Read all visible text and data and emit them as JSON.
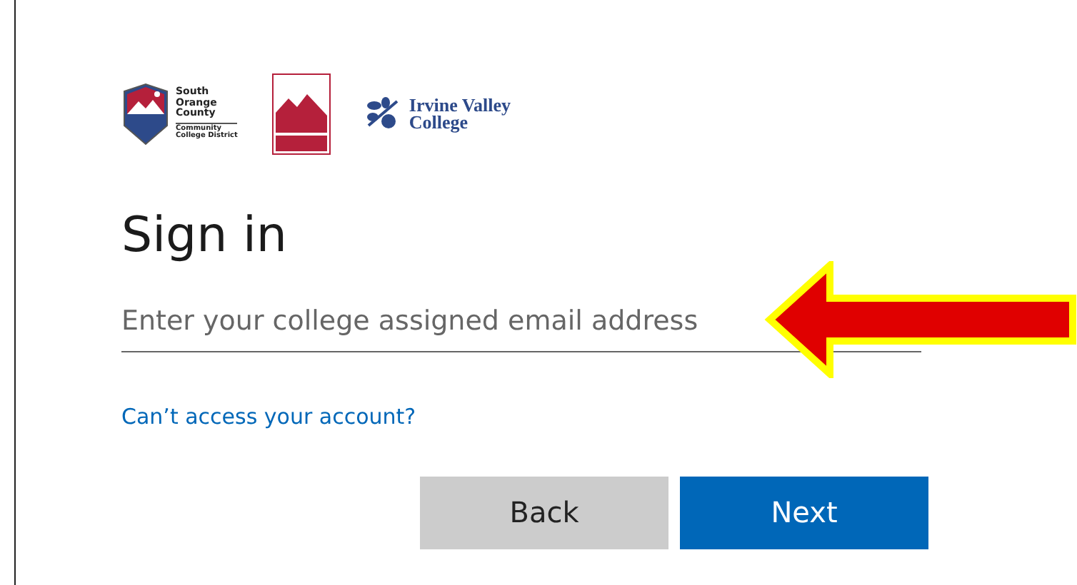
{
  "logos": {
    "district": [
      "South",
      "Orange",
      "County",
      "Community",
      "College District"
    ],
    "college": [
      "Irvine Valley",
      "College"
    ]
  },
  "title": "Sign in",
  "email": {
    "placeholder": "Enter your college assigned email address"
  },
  "link": "Can’t access your account?",
  "buttons": [
    {
      "label": "Back",
      "kind": "secondary"
    },
    {
      "label": "Next",
      "kind": "primary"
    }
  ]
}
